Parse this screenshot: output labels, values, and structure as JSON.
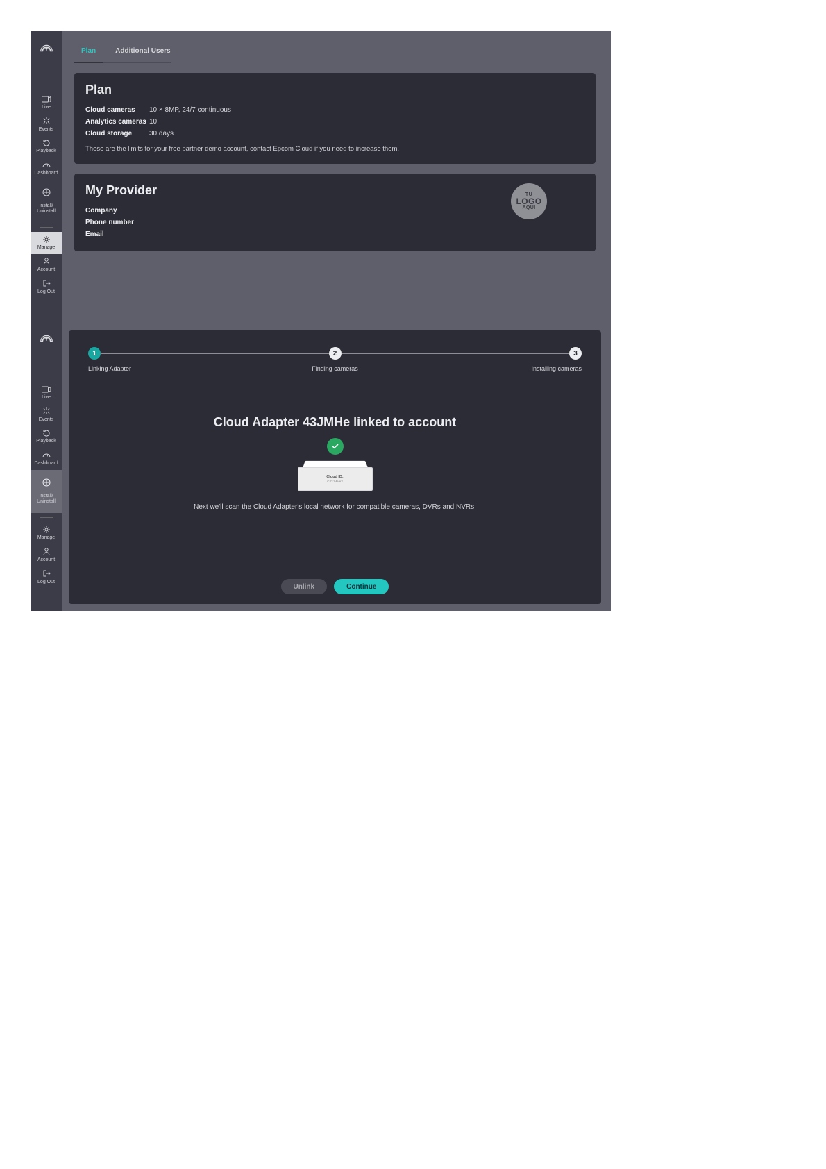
{
  "brand": "epcom",
  "sidebar": {
    "items": [
      {
        "label": "Live"
      },
      {
        "label": "Events"
      },
      {
        "label": "Playback"
      },
      {
        "label": "Dashboard"
      },
      {
        "label": "Install/\nUninstall"
      },
      {
        "label": "Manage"
      },
      {
        "label": "Account"
      },
      {
        "label": "Log Out"
      }
    ]
  },
  "pane1": {
    "tabs": [
      {
        "label": "Plan",
        "active": true
      },
      {
        "label": "Additional Users",
        "active": false
      }
    ],
    "plan": {
      "title": "Plan",
      "rows": [
        {
          "k": "Cloud cameras",
          "v": "10 × 8MP, 24/7 continuous"
        },
        {
          "k": "Analytics cameras",
          "v": "10"
        },
        {
          "k": "Cloud storage",
          "v": "30 days"
        }
      ],
      "note": "These are the limits for your free partner demo account, contact Epcom Cloud if you need to increase them."
    },
    "provider": {
      "title": "My Provider",
      "rows": [
        {
          "k": "Company"
        },
        {
          "k": "Phone number"
        },
        {
          "k": "Email"
        }
      ],
      "logo": {
        "line1": "TU",
        "line2": "LOGO",
        "line3": "AQUI"
      }
    }
  },
  "pane2": {
    "steps": [
      {
        "num": "1",
        "label": "Linking Adapter",
        "active": true
      },
      {
        "num": "2",
        "label": "Finding cameras",
        "active": false
      },
      {
        "num": "3",
        "label": "Installing cameras",
        "active": false
      }
    ],
    "heading": "Cloud Adapter 43JMHe linked to account",
    "adapter": {
      "l1": "Cloud ID:",
      "l2": "C43JMHe3"
    },
    "subtext": "Next we'll scan the Cloud Adapter's local network for compatible cameras, DVRs and NVRs.",
    "buttons": {
      "unlink": "Unlink",
      "continue": "Continue"
    }
  }
}
